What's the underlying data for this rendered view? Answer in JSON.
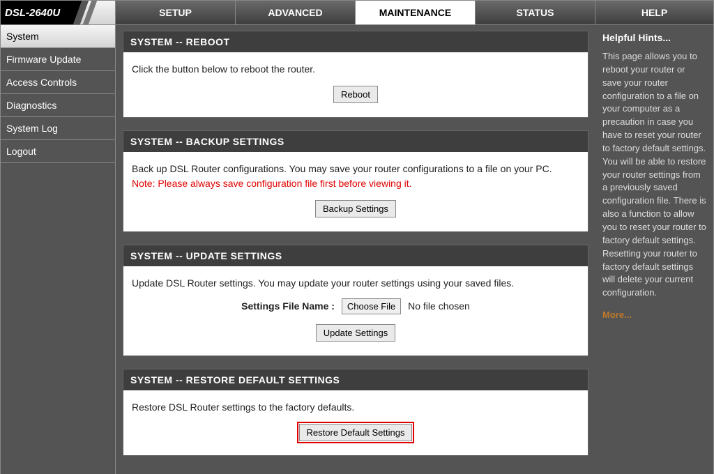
{
  "logo": {
    "model": "DSL-2640U"
  },
  "topnav": {
    "setup": "SETUP",
    "advanced": "ADVANCED",
    "maintenance": "MAINTENANCE",
    "status": "STATUS",
    "help": "HELP"
  },
  "sidebar": {
    "system": "System",
    "firmware": "Firmware Update",
    "access": "Access Controls",
    "diagnostics": "Diagnostics",
    "syslog": "System Log",
    "logout": "Logout"
  },
  "reboot": {
    "title": "SYSTEM -- REBOOT",
    "desc": "Click the button below to reboot the router.",
    "btn": "Reboot"
  },
  "backup": {
    "title": "SYSTEM -- BACKUP SETTINGS",
    "desc": "Back up DSL Router configurations. You may save your router configurations to a file on your PC.",
    "note": "Note: Please always save configuration file first before viewing it.",
    "btn": "Backup Settings"
  },
  "update": {
    "title": "SYSTEM -- UPDATE SETTINGS",
    "desc": "Update DSL Router settings. You may update your router settings using your saved files.",
    "file_label": "Settings File Name :",
    "choose": "Choose File",
    "nofile": "No file chosen",
    "btn": "Update Settings"
  },
  "restore": {
    "title": "SYSTEM -- RESTORE DEFAULT SETTINGS",
    "desc": "Restore DSL Router settings to the factory defaults.",
    "btn": "Restore Default Settings"
  },
  "help": {
    "heading": "Helpful Hints...",
    "body": "This page allows you to reboot your router or save your router configuration to a file on your computer as a precaution in case you have to reset your router to factory default settings. You will be able to restore your router settings from a previously saved configuration file. There is also a function to allow you to reset your router to factory default settings. Resetting your router to factory default settings will delete your current configuration.",
    "more": "More..."
  }
}
